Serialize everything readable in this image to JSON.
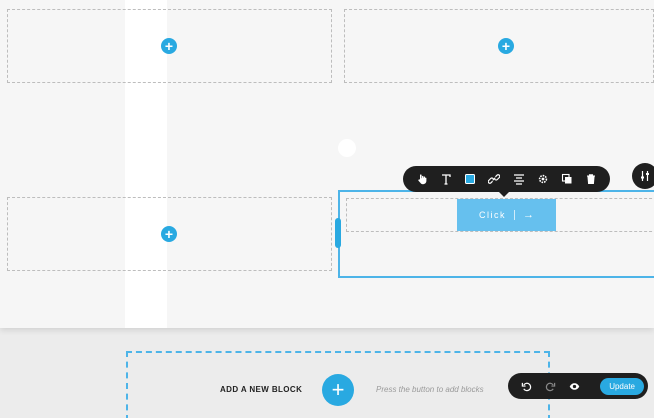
{
  "canvas": {
    "add_icon_glyph": "+",
    "cta_label": "Click",
    "cta_arrow": "→"
  },
  "toolbar": {
    "items": [
      "hand-icon",
      "text-icon",
      "color-icon",
      "link-icon",
      "align-icon",
      "settings-icon",
      "duplicate-icon",
      "delete-icon"
    ]
  },
  "add_block": {
    "title": "ADD A NEW BLOCK",
    "button_glyph": "+",
    "hint": "Press the button to add blocks"
  },
  "bottom_bar": {
    "update_label": "Update"
  },
  "colors": {
    "accent": "#29a9e1",
    "accent_light": "#66c0ee",
    "toolbar_bg": "#1f1f1f"
  }
}
